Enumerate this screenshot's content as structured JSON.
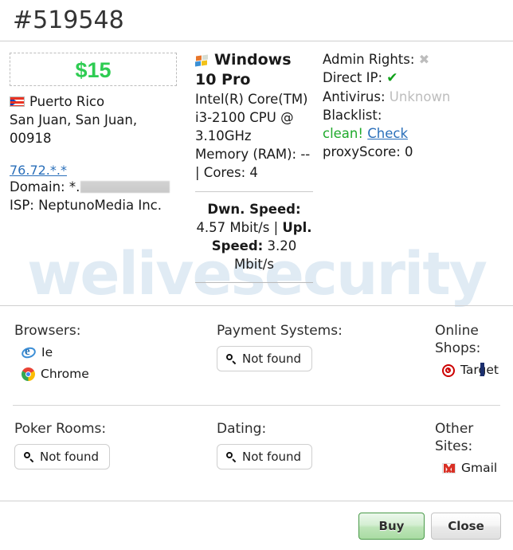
{
  "header": {
    "title": "#519548"
  },
  "watermark": {
    "text": "welivesecurity"
  },
  "left": {
    "price": "$15",
    "country": "Puerto Rico",
    "location": "San Juan, San Juan,",
    "zip": "00918",
    "ip": "76.72.*.*",
    "domain_label": "Domain: *.",
    "isp": "ISP: NeptunoMedia Inc."
  },
  "system": {
    "os_name": "Windows 10 Pro",
    "cpu": "Intel(R) Core(TM) i3-2100 CPU @ 3.10GHz",
    "memory_cores": "Memory (RAM): -- | Cores: 4",
    "dwn_speed_label": "Dwn. Speed:",
    "dwn_speed_value": "4.57 Mbit/s",
    "separator": "|",
    "upl_speed_label": "Upl. Speed:",
    "upl_speed_value": "3.20 Mbit/s"
  },
  "security": {
    "admin_rights_label": "Admin Rights:",
    "admin_rights_value": "✖",
    "direct_ip_label": "Direct IP:",
    "direct_ip_value": "✔",
    "antivirus_label": "Antivirus:",
    "antivirus_value": "Unknown",
    "blacklist_label": "Blacklist:",
    "blacklist_value": "clean!",
    "check_link": "Check",
    "proxy_score": "proxyScore: 0"
  },
  "bands": [
    {
      "columns": [
        {
          "title": "Browsers:",
          "items": [
            {
              "label": "Ie",
              "icon": "internet-explorer-icon"
            },
            {
              "label": "Chrome",
              "icon": "chrome-icon"
            }
          ]
        },
        {
          "title": "Payment Systems:",
          "button": "Not found"
        },
        {
          "title": "Online Shops:",
          "items": [
            {
              "label": "Target",
              "icon": "target-icon"
            }
          ]
        }
      ]
    },
    {
      "columns": [
        {
          "title": "Poker Rooms:",
          "button": "Not found"
        },
        {
          "title": "Dating:",
          "button": "Not found"
        },
        {
          "title": "Other Sites:",
          "items": [
            {
              "label": "Gmail",
              "icon": "gmail-icon"
            }
          ]
        }
      ]
    }
  ],
  "footer": {
    "buy_label": "Buy",
    "close_label": "Close"
  },
  "colors": {
    "price_green": "#2ecc52",
    "link_blue": "#2a6fba",
    "clean_green": "#1faa2b",
    "buy_green_border": "#4a9a4a",
    "watermark_blue": "#dbe8f3"
  }
}
